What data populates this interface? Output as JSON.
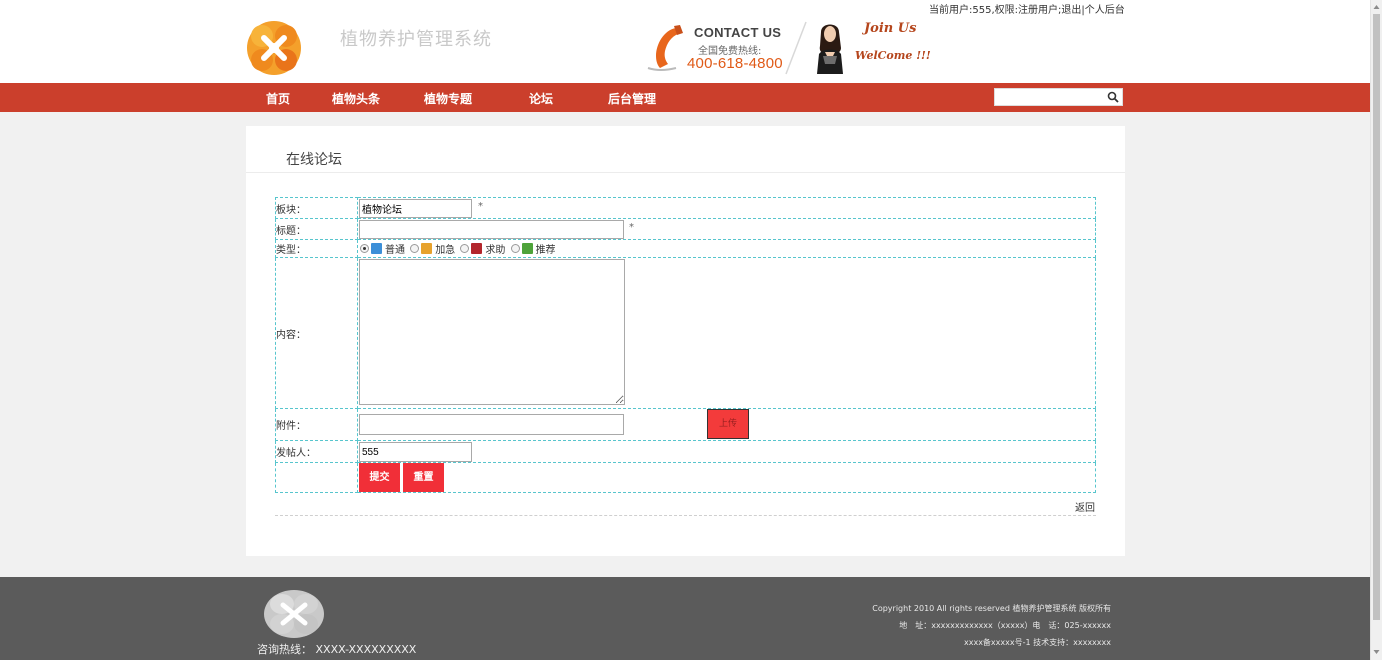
{
  "header": {
    "user_info": "当前用户:555,权限:注册用户;",
    "logout_label": "退出",
    "personal_label": "个人后台",
    "site_title": "植物养护管理系统",
    "contact_title": "CONTACT US",
    "contact_sub": "全国免费热线:",
    "contact_phone": "400-618-4800",
    "join_text": "Join Us",
    "welcome_text": "WelCome !!!"
  },
  "nav": {
    "items": [
      "首页",
      "植物头条",
      "植物专题",
      "论坛",
      "后台管理"
    ],
    "search_placeholder": ""
  },
  "page": {
    "title": "在线论坛",
    "form": {
      "section_label": "板块：",
      "section_value": "植物论坛",
      "title_label": "标题：",
      "title_value": "",
      "type_label": "类型：",
      "types": [
        "普通",
        "加急",
        "求助",
        "推荐"
      ],
      "selected_type": "普通",
      "content_label": "内容：",
      "content_value": "",
      "attachment_label": "附件：",
      "attachment_value": "",
      "upload_label": "上传",
      "poster_label": "发帖人：",
      "poster_value": "555",
      "required_mark": "*",
      "submit_label": "提交",
      "reset_label": "重置"
    },
    "back_label": "返回"
  },
  "footer": {
    "hotline": "咨询热线： XXXX-XXXXXXXXX",
    "copyright": "Copyright 2010 All rights reserved 植物养护管理系统 版权所有",
    "address": "地　址：xxxxxxxxxxxxx（xxxxx）电　话：025-xxxxxx",
    "icp": "xxxx备xxxxx号-1 技术支持：xxxxxxxx"
  },
  "colors": {
    "nav_bg": "#cb3f2c",
    "button_red": "#f12f38",
    "table_border": "#57c5cd",
    "footer_bg": "#5b5b5b",
    "logo_orange": "#f08a1f"
  }
}
